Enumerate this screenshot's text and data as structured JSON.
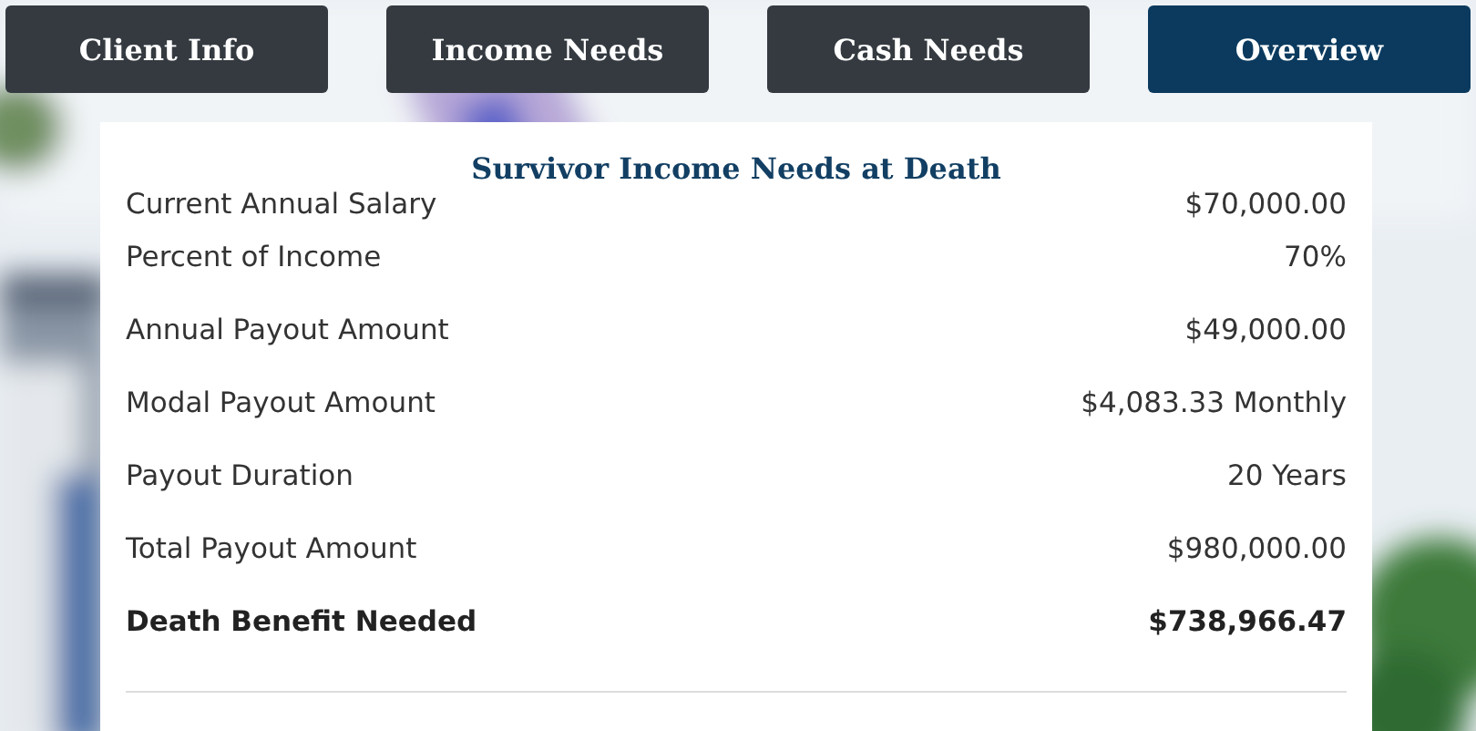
{
  "tabs": [
    {
      "label": "Client Info",
      "selected": false
    },
    {
      "label": "Income Needs",
      "selected": false
    },
    {
      "label": "Cash Needs",
      "selected": false
    },
    {
      "label": "Overview",
      "selected": true
    }
  ],
  "card": {
    "title": "Survivor Income Needs at Death",
    "rows": [
      {
        "label": "Current Annual Salary",
        "value": "$70,000.00",
        "kind": "normal"
      },
      {
        "label": "Percent of Income",
        "value": "70%",
        "kind": "normal"
      },
      {
        "label": "Annual Payout Amount",
        "value": "$49,000.00",
        "kind": "normal"
      },
      {
        "label": "Modal Payout Amount",
        "value": "$4,083.33 Monthly",
        "kind": "normal"
      },
      {
        "label": "Payout Duration",
        "value": "20 Years",
        "kind": "normal"
      },
      {
        "label": "Total Payout Amount",
        "value": "$980,000.00",
        "kind": "normal"
      },
      {
        "label": "Death Benefit Needed",
        "value": "$738,966.47",
        "kind": "total"
      }
    ]
  }
}
